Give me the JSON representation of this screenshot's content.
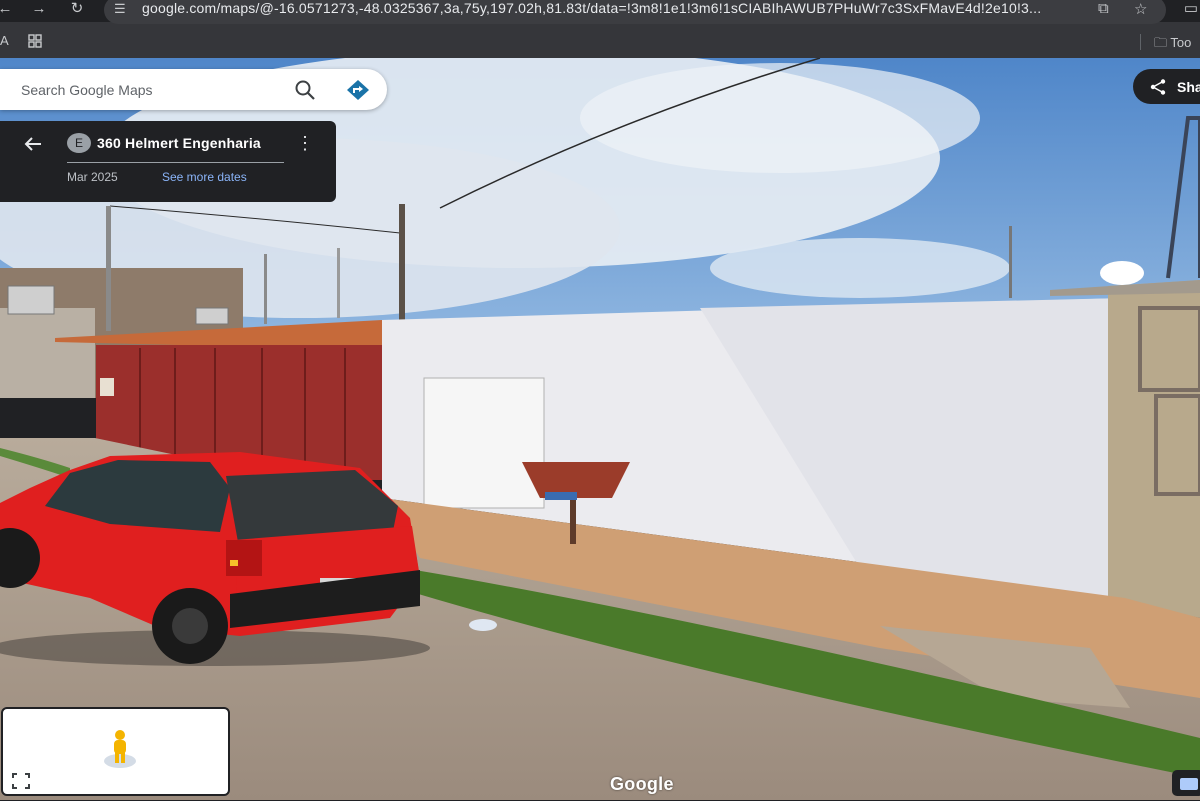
{
  "browser": {
    "back_icon": "arrow-left-icon",
    "forward_icon": "arrow-right-icon",
    "reload_icon": "reload-icon",
    "url": "google.com/maps/@-16.0571273,-48.0325367,3a,75y,197.02h,81.83t/data=!3m8!1e1!3m6!1sCIABIhAWUB7PHuWr7c3SxFMavE4d!2e10!3...",
    "bookmark_letter": "A",
    "bookmark_folder": "Too"
  },
  "search": {
    "placeholder": "Search Google Maps"
  },
  "place_card": {
    "badge": "E",
    "title": "360 Helmert Engenharia",
    "date": "Mar 2025",
    "see_more": "See more dates"
  },
  "share": {
    "label": "Sha"
  },
  "footer": {
    "logo": "Google"
  },
  "colors": {
    "chrome_dark": "#202124",
    "chrome": "#35363a",
    "link": "#8ab4f8",
    "directions_teal": "#1a73a8",
    "car_red": "#e01f1f"
  }
}
